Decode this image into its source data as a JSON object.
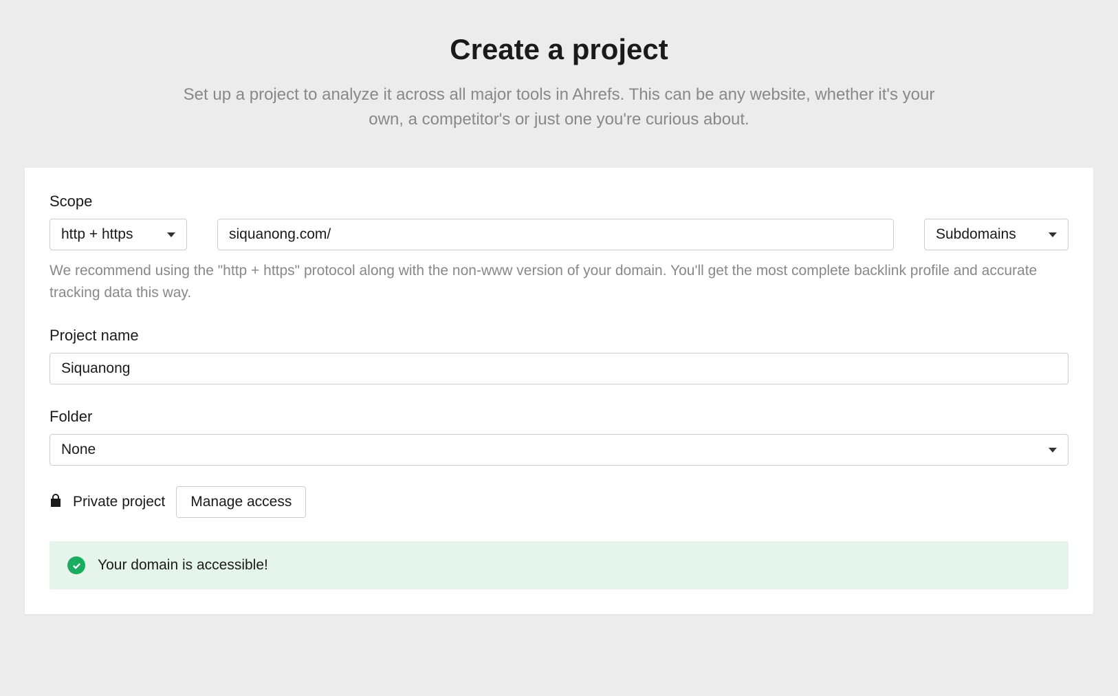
{
  "header": {
    "title": "Create a project",
    "subtitle": "Set up a project to analyze it across all major tools in Ahrefs. This can be any website, whether it's your own, a competitor's or just one you're curious about."
  },
  "scope": {
    "label": "Scope",
    "protocol_selected": "http + https",
    "url_value": "siquanong.com/",
    "subdomains_selected": "Subdomains",
    "help_text": "We recommend using the \"http + https\" protocol along with the non-www version of your domain. You'll get the most complete backlink profile and accurate tracking data this way."
  },
  "project_name": {
    "label": "Project name",
    "value": "Siquanong"
  },
  "folder": {
    "label": "Folder",
    "selected": "None"
  },
  "privacy": {
    "label": "Private project",
    "manage_label": "Manage access"
  },
  "status": {
    "message": "Your domain is accessible!"
  }
}
